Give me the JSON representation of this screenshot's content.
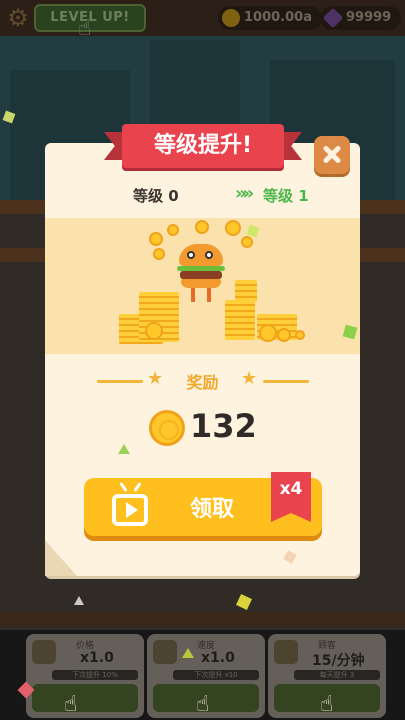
{
  "top_bar": {
    "level_up_label": "LEVEL UP!",
    "coins": "1000.00a",
    "gems": "99999"
  },
  "modal": {
    "title": "等级提升!",
    "level_from": "等级 0",
    "level_to": "等级 1",
    "reward_label": "奖励",
    "reward_amount": "132",
    "claim_label": "领取",
    "multiplier_badge": "x4"
  },
  "bottom_cards": [
    {
      "title": "价格",
      "value": "x1.0",
      "progress_text": "下次提升 10%"
    },
    {
      "title": "速度",
      "value": "x1.0",
      "progress_text": "下次提升 x10"
    },
    {
      "title": "顾客",
      "value": "15/分钟",
      "progress_text": "每天提升 3"
    }
  ],
  "colors": {
    "ribbon": "#e9434e",
    "claim_button": "#ffbf1f",
    "level_to": "#4db84a",
    "reward_accent": "#f0a92c"
  }
}
